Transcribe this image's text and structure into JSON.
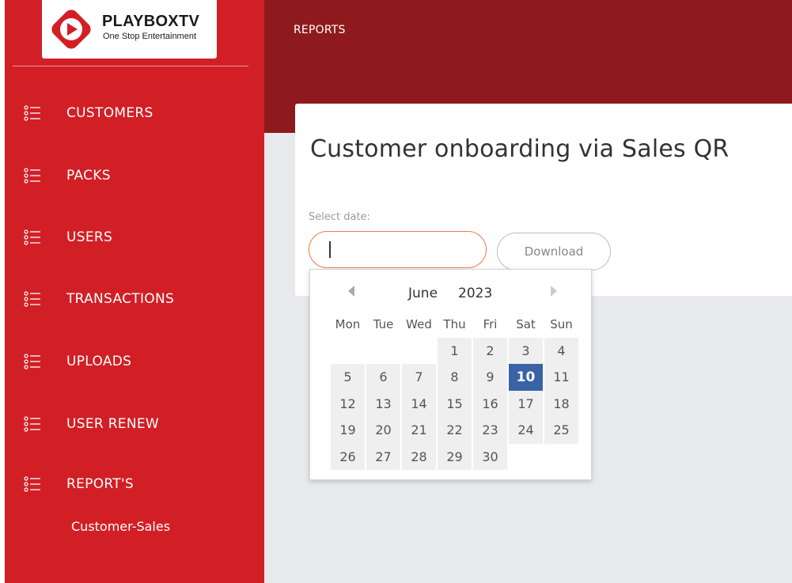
{
  "logo": {
    "brand_main": "PLAYBOX",
    "brand_accent": "TV",
    "tagline": "One Stop Entertainment"
  },
  "sidebar": {
    "items": [
      {
        "label": "CUSTOMERS",
        "icon": "list-icon"
      },
      {
        "label": "PACKS",
        "icon": "list-icon"
      },
      {
        "label": "USERS",
        "icon": "list-icon"
      },
      {
        "label": "TRANSACTIONS",
        "icon": "list-icon"
      },
      {
        "label": "UPLOADS",
        "icon": "list-icon"
      },
      {
        "label": "USER RENEW",
        "icon": "list-icon"
      },
      {
        "label": "REPORT'S",
        "icon": "list-icon"
      }
    ],
    "subitems": [
      {
        "label": "Customer-Sales"
      }
    ]
  },
  "header": {
    "breadcrumb": "REPORTS"
  },
  "main": {
    "title": "Customer onboarding via Sales QR",
    "date_label": "Select date:",
    "date_value": "",
    "download_label": "Download"
  },
  "datepicker": {
    "month": "June",
    "year": "2023",
    "weekdays": [
      "Mon",
      "Tue",
      "Wed",
      "Thu",
      "Fri",
      "Sat",
      "Sun"
    ],
    "days": [
      "",
      "",
      "",
      "1",
      "2",
      "3",
      "4",
      "5",
      "6",
      "7",
      "8",
      "9",
      "10",
      "11",
      "12",
      "13",
      "14",
      "15",
      "16",
      "17",
      "18",
      "19",
      "20",
      "21",
      "22",
      "23",
      "24",
      "25",
      "26",
      "27",
      "28",
      "29",
      "30"
    ],
    "selected_day": "10"
  },
  "colors": {
    "sidebar": "#d21f26",
    "header": "#8e1a1d",
    "content_bg": "#e8e9ed",
    "input_border": "#e97a4a",
    "selected_day": "#3a63a6"
  }
}
